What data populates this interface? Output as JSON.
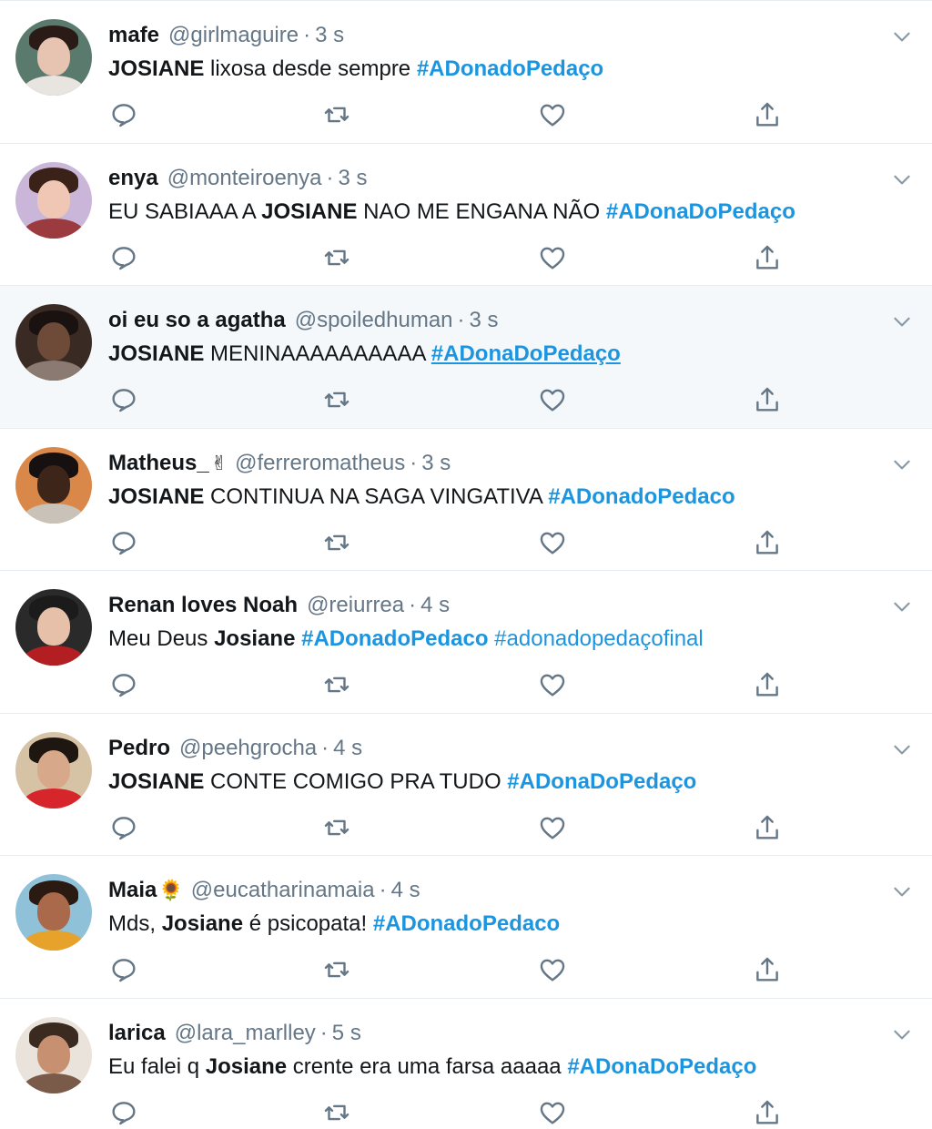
{
  "tweets": [
    {
      "name": "mafe",
      "emoji": "",
      "handle": "@girlmaguire",
      "time": "3 s",
      "avatar": {
        "bg": "#5b7a6e",
        "skin": "#e7c3b1",
        "hair": "#2b1b16",
        "shirt": "#e8e4df"
      },
      "parts": [
        {
          "t": "JOSIANE",
          "s": "bold"
        },
        {
          "t": " lixosa desde sempre ",
          "s": "plain"
        },
        {
          "t": "#ADonadoPedaço",
          "s": "tag"
        }
      ]
    },
    {
      "name": "enya",
      "emoji": "",
      "handle": "@monteiroenya",
      "time": "3 s",
      "avatar": {
        "bg": "#c9b6d9",
        "skin": "#f0c7b4",
        "hair": "#3a2218",
        "shirt": "#9b3a3f"
      },
      "parts": [
        {
          "t": "EU SABIAAA A ",
          "s": "plain"
        },
        {
          "t": "JOSIANE",
          "s": "bold"
        },
        {
          "t": " NAO ME ENGANA NÃO ",
          "s": "plain"
        },
        {
          "t": "#ADonaDoPedaço",
          "s": "tag"
        }
      ]
    },
    {
      "name": "oi eu so a agatha",
      "emoji": "",
      "handle": "@spoiledhuman",
      "time": "3 s",
      "avatar": {
        "bg": "#3a2a24",
        "skin": "#6e4a39",
        "hair": "#1a1210",
        "shirt": "#8a7a72"
      },
      "parts": [
        {
          "t": "JOSIANE",
          "s": "bold"
        },
        {
          "t": " MENINAAAAAAAAAA ",
          "s": "plain"
        },
        {
          "t": "#ADonaDoPedaço",
          "s": "tag-u"
        }
      ]
    },
    {
      "name": "Matheus_",
      "emoji": "✌",
      "handle": "@ferreromatheus",
      "time": "3 s",
      "avatar": {
        "bg": "#d9884a",
        "skin": "#3d2519",
        "hair": "#161010",
        "shirt": "#c9c2b8"
      },
      "parts": [
        {
          "t": "JOSIANE",
          "s": "bold"
        },
        {
          "t": " CONTINUA NA SAGA VINGATIVA ",
          "s": "plain"
        },
        {
          "t": "#ADonadoPedaco",
          "s": "tag"
        }
      ]
    },
    {
      "name": "Renan loves Noah",
      "emoji": "",
      "handle": "@reiurrea",
      "time": "4 s",
      "avatar": {
        "bg": "#2a2a2a",
        "skin": "#e6c0a8",
        "hair": "#1b1b1b",
        "shirt": "#b31e22"
      },
      "parts": [
        {
          "t": "Meu Deus ",
          "s": "plain"
        },
        {
          "t": "Josiane",
          "s": "bold"
        },
        {
          "t": " ",
          "s": "plain"
        },
        {
          "t": "#ADonadoPedaco",
          "s": "tag"
        },
        {
          "t": " ",
          "s": "plain"
        },
        {
          "t": "#adonadopedaçofinal",
          "s": "tag-plain"
        }
      ]
    },
    {
      "name": "Pedro",
      "emoji": "",
      "handle": "@peehgrocha",
      "time": "4 s",
      "avatar": {
        "bg": "#d6c3a5",
        "skin": "#d7a889",
        "hair": "#1e1611",
        "shirt": "#d6262c"
      },
      "parts": [
        {
          "t": "JOSIANE",
          "s": "bold"
        },
        {
          "t": " CONTE COMIGO PRA TUDO ",
          "s": "plain"
        },
        {
          "t": "#ADonaDoPedaço",
          "s": "tag"
        }
      ]
    },
    {
      "name": "Maia",
      "emoji": "🌻",
      "handle": "@eucatharinamaia",
      "time": "4 s",
      "avatar": {
        "bg": "#8fc1d9",
        "skin": "#a9694a",
        "hair": "#2a1a12",
        "shirt": "#e6a22a"
      },
      "parts": [
        {
          "t": "Mds, ",
          "s": "plain"
        },
        {
          "t": "Josiane",
          "s": "bold"
        },
        {
          "t": " é psicopata! ",
          "s": "plain"
        },
        {
          "t": "#ADonadoPedaco",
          "s": "tag"
        }
      ]
    },
    {
      "name": "larica",
      "emoji": "",
      "handle": "@lara_marlley",
      "time": "5 s",
      "avatar": {
        "bg": "#e9e3db",
        "skin": "#c79070",
        "hair": "#3b2a20",
        "shirt": "#7a5a48"
      },
      "parts": [
        {
          "t": "Eu falei q ",
          "s": "plain"
        },
        {
          "t": "Josiane",
          "s": "bold"
        },
        {
          "t": " crente era uma farsa aaaaa ",
          "s": "plain"
        },
        {
          "t": "#ADonaDoPedaço",
          "s": "tag"
        }
      ]
    }
  ],
  "hover_index": 2,
  "colors": {
    "link": "#1b95e0",
    "muted": "#657786",
    "divider": "#e6ecf0",
    "hover_bg": "#f5f8fa"
  },
  "icons": [
    "reply-icon",
    "retweet-icon",
    "like-icon",
    "share-icon",
    "chevron-down-icon"
  ]
}
